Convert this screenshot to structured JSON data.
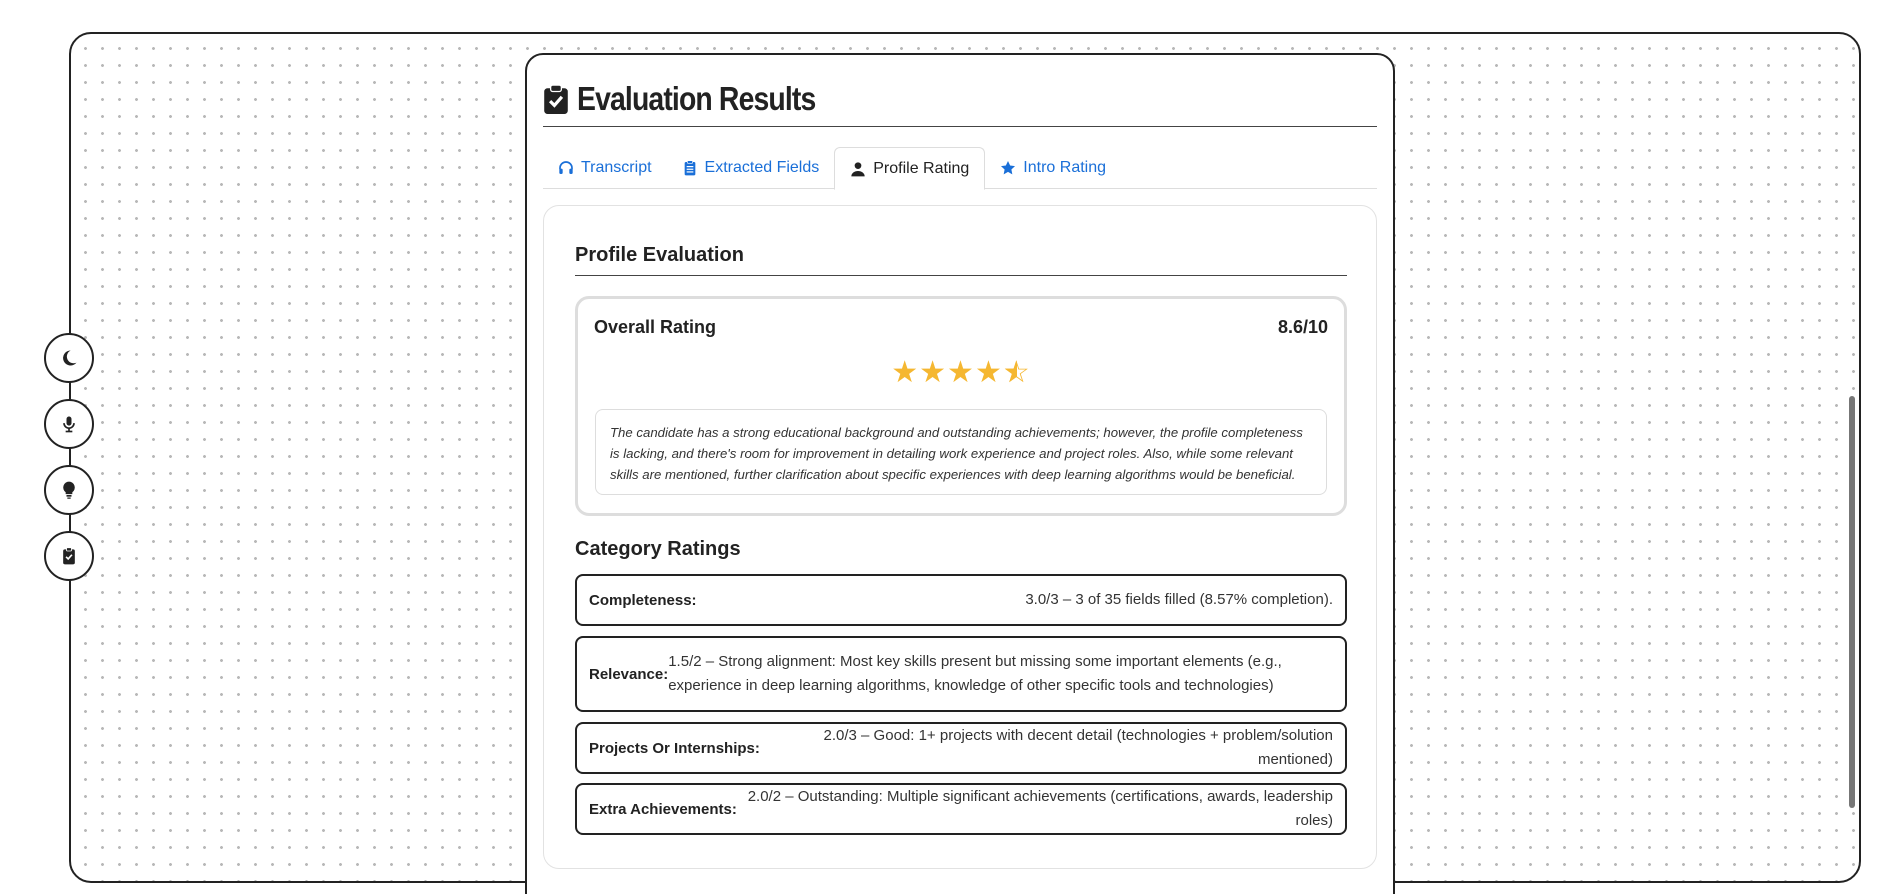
{
  "header": {
    "title": "Evaluation Results"
  },
  "tabs": [
    {
      "label": "Transcript",
      "icon": "headphones-icon",
      "active": false
    },
    {
      "label": "Extracted Fields",
      "icon": "clipboard-list-icon",
      "active": false
    },
    {
      "label": "Profile Rating",
      "icon": "user-icon",
      "active": true
    },
    {
      "label": "Intro Rating",
      "icon": "star-icon",
      "active": false
    }
  ],
  "side_rail": [
    {
      "icon": "moon-icon"
    },
    {
      "icon": "microphone-icon"
    },
    {
      "icon": "lightbulb-icon"
    },
    {
      "icon": "clipboard-check-icon"
    }
  ],
  "profile": {
    "section_title": "Profile Evaluation",
    "overall_label": "Overall Rating",
    "overall_score": "8.6/10",
    "stars": {
      "full": 4,
      "half": 1,
      "max": 5
    },
    "summary": "The candidate has a strong educational background and outstanding achievements; however, the profile completeness is lacking, and there's room for improvement in detailing work experience and project roles. Also, while some relevant skills are mentioned, further clarification about specific experiences with deep learning algorithms would be beneficial.",
    "category_title": "Category Ratings",
    "categories": [
      {
        "label": "Completeness:",
        "value": "3.0/3 – 3 of 35 fields filled (8.57% completion)."
      },
      {
        "label": "Relevance:",
        "value": "1.5/2 – Strong alignment: Most key skills present but missing some important elements (e.g., experience in deep learning algorithms, knowledge of other specific tools and technologies)"
      },
      {
        "label": "Projects Or Internships:",
        "value": "2.0/3 – Good: 1+ projects with decent detail (technologies + problem/solution mentioned)"
      },
      {
        "label": "Extra Achievements:",
        "value": "2.0/2 – Outstanding: Multiple significant achievements (certifications, awards, leadership roles)"
      }
    ]
  },
  "colors": {
    "accent": "#1a6fd8",
    "star": "#f5b731",
    "border": "#222222"
  }
}
